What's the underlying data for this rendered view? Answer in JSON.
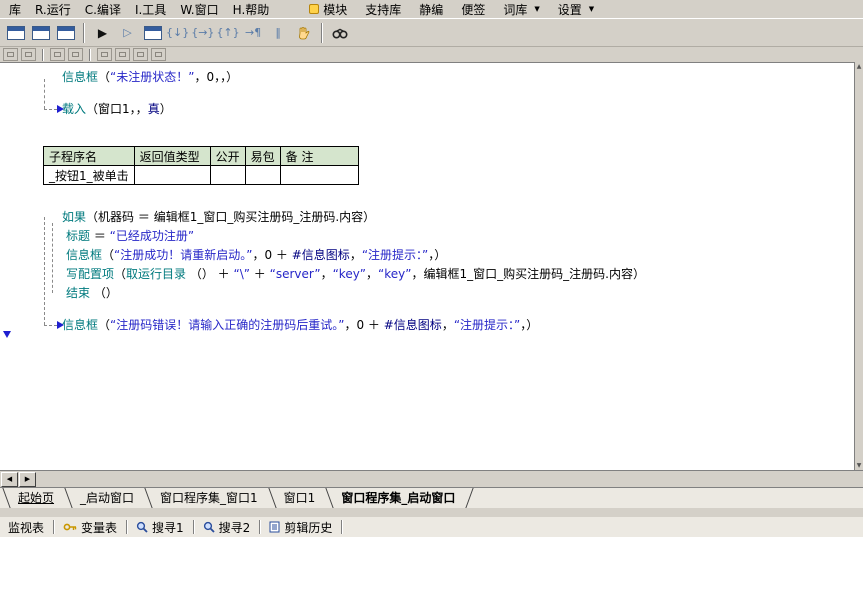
{
  "colors": {
    "keyword": "#007a7e",
    "string": "#2727c8",
    "constant": "#000080",
    "table_header_bg": "#d5e5cd",
    "chrome": "#d4d0c8",
    "marker_blue": "#1f1fd0"
  },
  "menubar": {
    "left_items": [
      "库",
      "R.运行",
      "C.编译",
      "I.工具",
      "W.窗口",
      "H.帮助"
    ],
    "right_items": [
      {
        "label": "模块",
        "icon": "module-icon",
        "arrow": false
      },
      {
        "label": "支持库",
        "icon": "",
        "arrow": false
      },
      {
        "label": "静编",
        "icon": "",
        "arrow": false
      },
      {
        "label": "便签",
        "icon": "",
        "arrow": false
      },
      {
        "label": "词库",
        "icon": "",
        "arrow": true
      },
      {
        "label": "设置",
        "icon": "",
        "arrow": true
      }
    ],
    "dropdown_glyph": "▼"
  },
  "toolbar_main": {
    "icons": [
      {
        "name": "new-form-icon",
        "kind": "form"
      },
      {
        "name": "open-form-icon",
        "kind": "form"
      },
      {
        "name": "form-designer-icon",
        "kind": "form"
      },
      {
        "name": "separator",
        "kind": "sep"
      },
      {
        "name": "run-icon",
        "kind": "glyph",
        "glyph": "▶"
      },
      {
        "name": "run-alt-icon",
        "kind": "glyph",
        "glyph": "▷"
      },
      {
        "name": "debug-form-icon",
        "kind": "form"
      },
      {
        "name": "step-into-icon",
        "kind": "glyph",
        "glyph": "{↓}"
      },
      {
        "name": "step-over-icon",
        "kind": "glyph",
        "glyph": "{→}"
      },
      {
        "name": "step-out-icon",
        "kind": "glyph",
        "glyph": "{↑}"
      },
      {
        "name": "run-to-cursor-icon",
        "kind": "glyph",
        "glyph": "→¶"
      },
      {
        "name": "pause-icon",
        "kind": "glyph",
        "glyph": "‖"
      },
      {
        "name": "hand-icon",
        "kind": "hand"
      },
      {
        "name": "separator",
        "kind": "sep"
      },
      {
        "name": "find-icon",
        "kind": "binocular"
      }
    ]
  },
  "toolbar_small": {
    "icons": [
      {
        "name": "halign-icon",
        "kind": "box"
      },
      {
        "name": "valign-icon",
        "kind": "box"
      },
      {
        "name": "separator",
        "kind": "sep"
      },
      {
        "name": "same-size-icon",
        "kind": "box"
      },
      {
        "name": "grid-snap-icon",
        "kind": "box"
      },
      {
        "name": "separator",
        "kind": "sep"
      },
      {
        "name": "order-front-icon",
        "kind": "box"
      },
      {
        "name": "order-back-icon",
        "kind": "box"
      },
      {
        "name": "order-up-icon",
        "kind": "box"
      },
      {
        "name": "order-down-icon",
        "kind": "box"
      }
    ]
  },
  "editor": {
    "block1": [
      {
        "segments": [
          {
            "t": "信息框",
            "c": "kw"
          },
          {
            "t": "（",
            "c": "tx"
          },
          {
            "t": "“未注册状态！”",
            "c": "str"
          },
          {
            "t": "，",
            "c": "tx"
          },
          {
            "t": "0",
            "c": "tx"
          },
          {
            "t": "，，）",
            "c": "tx"
          }
        ]
      },
      {
        "gap": true,
        "segments": [
          {
            "t": "载入",
            "c": "kw"
          },
          {
            "t": "（",
            "c": "tx"
          },
          {
            "t": "窗口1",
            "c": "tx"
          },
          {
            "t": "，，",
            "c": "tx"
          },
          {
            "t": "真",
            "c": "cst"
          },
          {
            "t": "）",
            "c": "tx"
          }
        ]
      }
    ],
    "table": {
      "headers": [
        "子程序名",
        "返回值类型",
        "公开",
        "易包",
        "备 注"
      ],
      "rows": [
        [
          "_按钮1_被单击",
          "",
          "",
          "",
          ""
        ]
      ]
    },
    "block2": [
      {
        "segments": [
          {
            "t": "如果",
            "c": "kw"
          },
          {
            "t": "（",
            "c": "tx"
          },
          {
            "t": "机器码",
            "c": "tx"
          },
          {
            "t": " ＝ ",
            "c": "tx"
          },
          {
            "t": "编辑框1_窗口_购买注册码_注册码.内容",
            "c": "tx"
          },
          {
            "t": "）",
            "c": "tx"
          }
        ]
      },
      {
        "indent": 1,
        "segments": [
          {
            "t": "标题",
            "c": "kw"
          },
          {
            "t": " ＝ ",
            "c": "tx"
          },
          {
            "t": "“已经成功注册”",
            "c": "str"
          }
        ]
      },
      {
        "indent": 1,
        "segments": [
          {
            "t": "信息框",
            "c": "kw"
          },
          {
            "t": "（",
            "c": "tx"
          },
          {
            "t": "“注册成功！请重新启动。”",
            "c": "str"
          },
          {
            "t": "，",
            "c": "tx"
          },
          {
            "t": "0 ＋ ",
            "c": "tx"
          },
          {
            "t": "#信息图标",
            "c": "cst"
          },
          {
            "t": "，",
            "c": "tx"
          },
          {
            "t": "“注册提示：”",
            "c": "str"
          },
          {
            "t": "，）",
            "c": "tx"
          }
        ]
      },
      {
        "indent": 1,
        "segments": [
          {
            "t": "写配置项",
            "c": "kw"
          },
          {
            "t": "（",
            "c": "tx"
          },
          {
            "t": "取运行目录",
            "c": "kw"
          },
          {
            "t": " （） ＋ ",
            "c": "tx"
          },
          {
            "t": "“\\”",
            "c": "str"
          },
          {
            "t": " ＋ ",
            "c": "tx"
          },
          {
            "t": "“server”",
            "c": "str"
          },
          {
            "t": "，",
            "c": "tx"
          },
          {
            "t": "“key”",
            "c": "str"
          },
          {
            "t": "，",
            "c": "tx"
          },
          {
            "t": "“key”",
            "c": "str"
          },
          {
            "t": "，",
            "c": "tx"
          },
          {
            "t": "编辑框1_窗口_购买注册码_注册码.内容",
            "c": "tx"
          },
          {
            "t": "）",
            "c": "tx"
          }
        ]
      },
      {
        "indent": 1,
        "segments": [
          {
            "t": "结束",
            "c": "kw"
          },
          {
            "t": " （）",
            "c": "tx"
          }
        ]
      }
    ],
    "block3": [
      {
        "segments": [
          {
            "t": "信息框",
            "c": "kw"
          },
          {
            "t": "（",
            "c": "tx"
          },
          {
            "t": "“注册码错误！请输入正确的注册码后重试。”",
            "c": "str"
          },
          {
            "t": "，",
            "c": "tx"
          },
          {
            "t": "0 ＋ ",
            "c": "tx"
          },
          {
            "t": "#信息图标",
            "c": "cst"
          },
          {
            "t": "，",
            "c": "tx"
          },
          {
            "t": "“注册提示：”",
            "c": "str"
          },
          {
            "t": "，）",
            "c": "tx"
          }
        ]
      }
    ]
  },
  "scrollbar": {
    "up": "▲",
    "down": "▼",
    "left": "◀",
    "right": "▶"
  },
  "tabbar": {
    "tabs": [
      {
        "label": "起始页",
        "active": false,
        "underline": true
      },
      {
        "label": "_启动窗口",
        "active": false,
        "underline": false
      },
      {
        "label": "窗口程序集_窗口1",
        "active": false,
        "underline": false
      },
      {
        "label": "窗口1",
        "active": false,
        "underline": false
      },
      {
        "label": "窗口程序集_启动窗口",
        "active": true,
        "underline": false
      }
    ]
  },
  "panelbar": {
    "items": [
      {
        "label": "监视表",
        "icon": ""
      },
      {
        "label": "变量表",
        "icon": "key-icon"
      },
      {
        "label": "搜寻1",
        "icon": "search-icon"
      },
      {
        "label": "搜寻2",
        "icon": "search-icon"
      },
      {
        "label": "剪辑历史",
        "icon": "clipboard-icon"
      }
    ]
  }
}
